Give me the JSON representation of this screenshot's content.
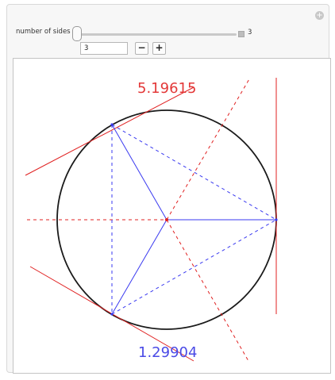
{
  "controls": {
    "label": "number of sides",
    "slider_value": "3",
    "field_value": "3",
    "minus_label": "−",
    "plus_label": "+",
    "sides": 3,
    "sides_range": [
      3,
      20
    ]
  },
  "plot": {
    "top_value": "5.19615",
    "bottom_value": "1.29904",
    "colors": {
      "circle": "#1a1a1a",
      "red": "#e02020",
      "blue": "#3a3af0"
    }
  },
  "icons": {
    "corner": "plus-circle-icon"
  }
}
